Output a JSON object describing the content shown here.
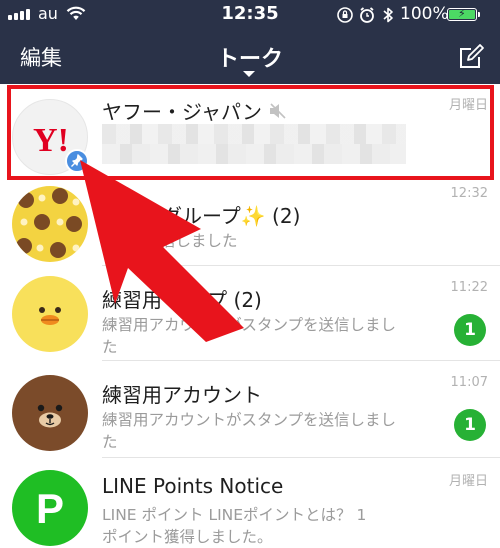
{
  "status_bar": {
    "carrier": "au",
    "time": "12:35",
    "battery_percent": "100%",
    "icons": [
      "signal-bars-icon",
      "wifi-icon",
      "rotation-lock-icon",
      "alarm-icon",
      "bluetooth-icon",
      "battery-charging-icon"
    ]
  },
  "header": {
    "edit_label": "編集",
    "title": "トーク",
    "compose_icon": "compose-icon"
  },
  "chats": [
    {
      "name": "ヤフー・ジャパン",
      "preview": "",
      "time": "月曜日",
      "muted": true,
      "pinned": true,
      "avatar": "yahoo-logo"
    },
    {
      "name": "グループ✨ (2)",
      "preview": "信しました",
      "time": "12:32",
      "avatar": "bear-pattern"
    },
    {
      "name": "練習用 ループ (2)",
      "preview": "練習用アカウントがスタンプを送信しました",
      "time": "11:22",
      "unread": "1",
      "avatar": "chick"
    },
    {
      "name": "練習用アカウント",
      "preview": "練習用アカウントがスタンプを送信しました",
      "time": "11:07",
      "unread": "1",
      "avatar": "bear"
    },
    {
      "name": "LINE Points Notice",
      "preview": "LINE ポイント LINEポイントとは？ 1ポイント獲得しました。",
      "time": "月曜日",
      "avatar": "points-p"
    }
  ],
  "colors": {
    "header_bg": "#2a3248",
    "highlight": "#e8141c",
    "unread_badge": "#27b135",
    "points_green": "#1fbe24",
    "yahoo_red": "#e00021"
  }
}
